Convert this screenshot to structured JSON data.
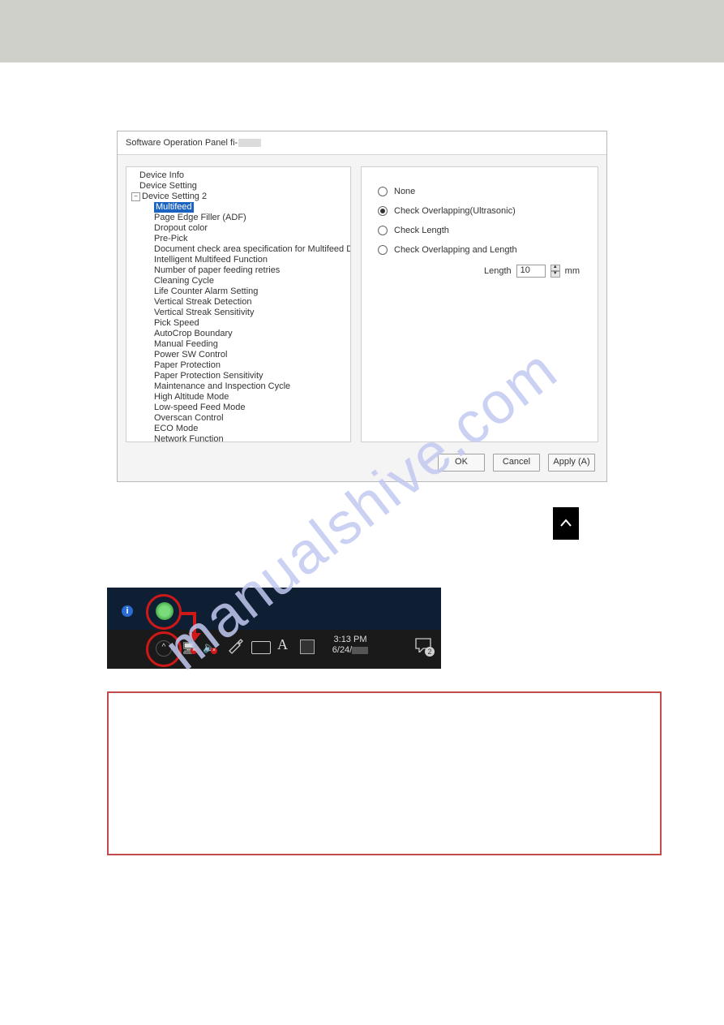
{
  "watermark_text": "manualshive.com",
  "window": {
    "title_prefix": "Software Operation Panel fi-",
    "tree": {
      "items": [
        {
          "label": "Device Info",
          "level": 0
        },
        {
          "label": "Device Setting",
          "level": 0
        },
        {
          "label": "Device Setting 2",
          "level": 0,
          "expanded": true
        },
        {
          "label": "Multifeed",
          "level": 1,
          "selected": true
        },
        {
          "label": "Page Edge Filler (ADF)",
          "level": 1
        },
        {
          "label": "Dropout color",
          "level": 1
        },
        {
          "label": "Pre-Pick",
          "level": 1
        },
        {
          "label": "Document check area specification for Multifeed Detection",
          "level": 1
        },
        {
          "label": "Intelligent Multifeed Function",
          "level": 1
        },
        {
          "label": "Number of paper feeding retries",
          "level": 1
        },
        {
          "label": "Cleaning Cycle",
          "level": 1
        },
        {
          "label": "Life Counter Alarm Setting",
          "level": 1
        },
        {
          "label": "Vertical Streak Detection",
          "level": 1
        },
        {
          "label": "Vertical Streak Sensitivity",
          "level": 1
        },
        {
          "label": "Pick Speed",
          "level": 1
        },
        {
          "label": "AutoCrop Boundary",
          "level": 1
        },
        {
          "label": "Manual Feeding",
          "level": 1
        },
        {
          "label": "Power SW Control",
          "level": 1
        },
        {
          "label": "Paper Protection",
          "level": 1
        },
        {
          "label": "Paper Protection Sensitivity",
          "level": 1
        },
        {
          "label": "Maintenance and Inspection Cycle",
          "level": 1
        },
        {
          "label": "High Altitude Mode",
          "level": 1
        },
        {
          "label": "Low-speed Feed Mode",
          "level": 1
        },
        {
          "label": "Overscan Control",
          "level": 1
        },
        {
          "label": "ECO Mode",
          "level": 1
        },
        {
          "label": "Network Function",
          "level": 1
        }
      ]
    },
    "options": {
      "none": "None",
      "overlap": "Check Overlapping(Ultrasonic)",
      "length": "Check Length",
      "both": "Check Overlapping and Length",
      "selected": "overlap",
      "length_label": "Length",
      "length_value": "10",
      "length_unit": "mm"
    },
    "buttons": {
      "ok": "OK",
      "cancel": "Cancel",
      "apply": "Apply (A)"
    }
  },
  "taskbar": {
    "time": "3:13 PM",
    "date": "6/24/",
    "letter": "A",
    "notif_count": "2"
  },
  "icons": {
    "chevron_up": "⌃",
    "info": "i"
  }
}
